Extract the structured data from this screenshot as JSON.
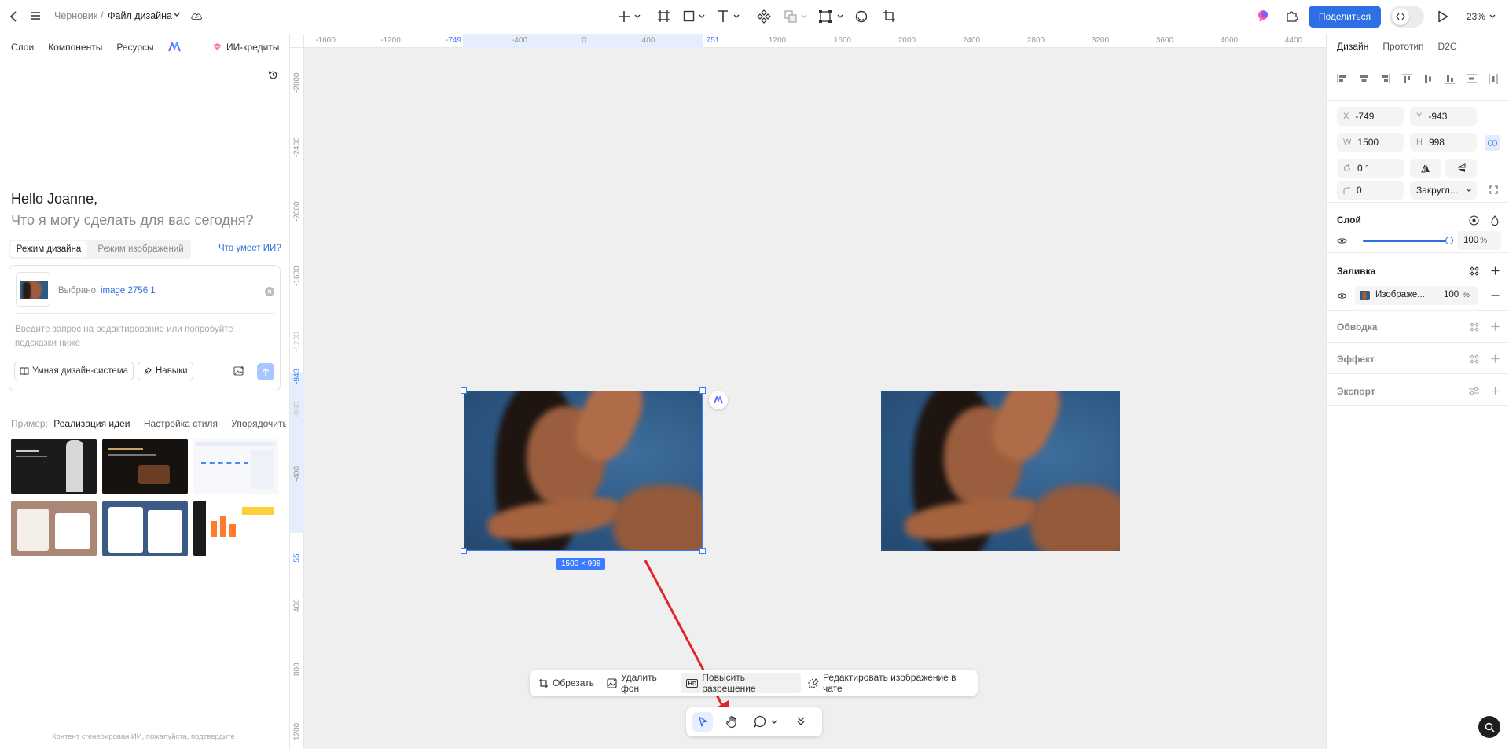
{
  "header": {
    "breadcrumb_root": "Черновик",
    "breadcrumb_sep": "/",
    "file_name": "Файл дизайна",
    "share_label": "Поделиться",
    "zoom": "23%"
  },
  "left_panel": {
    "tabs": [
      "Слои",
      "Компоненты",
      "Ресурсы"
    ],
    "ai_credits": "ИИ-кредиты",
    "greeting": "Hello Joanne,",
    "question": "Что я могу сделать для вас сегодня?",
    "mode_tabs": [
      "Режим дизайна",
      "Режим изображений"
    ],
    "what_ai_can": "Что умеет ИИ?",
    "selected_label": "Выбрано",
    "selected_name": "image 2756 1",
    "prompt_placeholder": "Введите запрос на редактирование или попробуйте подсказки ниже",
    "smart_design_btn": "Умная дизайн-система",
    "skills_btn": "Навыки",
    "examples_label": "Пример:",
    "example_tabs": [
      "Реализация идеи",
      "Настройка стиля",
      "Упорядочить с"
    ],
    "footer_note": "Контент сгенерирован ИИ, пожалуйста, подтвердите"
  },
  "rulers": {
    "h_ticks": [
      "-1600",
      "-1200",
      "-749",
      "-400",
      "0",
      "400",
      "751",
      "1200",
      "1600",
      "2000",
      "2400",
      "2800",
      "3200",
      "3600",
      "4000",
      "4400"
    ],
    "v_ticks": [
      "-2800",
      "-2400",
      "-2000",
      "-1600",
      "-1200",
      "-943",
      "-800",
      "-400",
      "55",
      "400",
      "800",
      "1200"
    ]
  },
  "canvas": {
    "size_badge": "1500 × 998"
  },
  "context_toolbar": {
    "crop": "Обрезать",
    "remove_bg": "Удалить фон",
    "hd_badge": "HD",
    "upscale": "Повысить разрешение",
    "edit_in_chat": "Редактировать изображение в чате"
  },
  "right_panel": {
    "tabs": [
      "Дизайн",
      "Прототип",
      "D2C"
    ],
    "x_label": "X",
    "x_value": "-749",
    "y_label": "Y",
    "y_value": "-943",
    "w_label": "W",
    "w_value": "1500",
    "h_label": "H",
    "h_value": "998",
    "rotation": "0 °",
    "radius": "0",
    "corner_mode": "Закругл...",
    "layer_title": "Слой",
    "opacity_value": "100",
    "opacity_unit": "%",
    "fill_title": "Заливка",
    "fill_name": "Изображе...",
    "fill_opacity": "100",
    "fill_unit": "%",
    "stroke_title": "Обводка",
    "effect_title": "Эффект",
    "export_title": "Экспорт"
  },
  "colors": {
    "accent": "#2f6fe4",
    "selection": "#3b7cff",
    "photo_bg": "#2e5a86",
    "skin": "#9a5e3e"
  }
}
